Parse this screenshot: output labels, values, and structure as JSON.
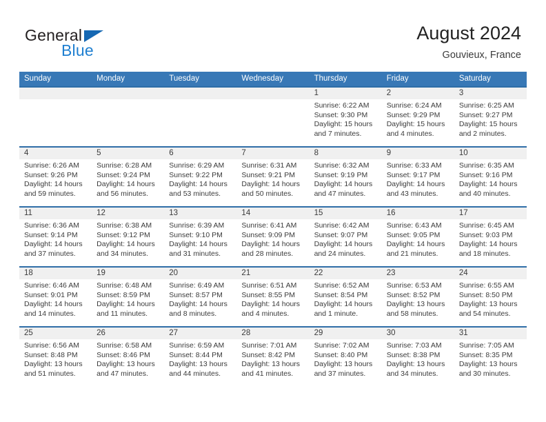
{
  "logo": {
    "text_top": "General",
    "text_bottom": "Blue",
    "triangle_color": "#1668b3",
    "blue_color": "#1f7fd0"
  },
  "header": {
    "title": "August 2024",
    "subtitle": "Gouvieux, France"
  },
  "theme": {
    "header_row_bg": "#3878b6",
    "row_divider": "#2e6da7",
    "daynum_band_bg": "#f0f0f0",
    "text": "#3a3a3a"
  },
  "weekdays": [
    "Sunday",
    "Monday",
    "Tuesday",
    "Wednesday",
    "Thursday",
    "Friday",
    "Saturday"
  ],
  "weeks": [
    [
      {
        "day": "",
        "sunrise": "",
        "sunset": "",
        "daylight1": "",
        "daylight2": ""
      },
      {
        "day": "",
        "sunrise": "",
        "sunset": "",
        "daylight1": "",
        "daylight2": ""
      },
      {
        "day": "",
        "sunrise": "",
        "sunset": "",
        "daylight1": "",
        "daylight2": ""
      },
      {
        "day": "",
        "sunrise": "",
        "sunset": "",
        "daylight1": "",
        "daylight2": ""
      },
      {
        "day": "1",
        "sunrise": "Sunrise: 6:22 AM",
        "sunset": "Sunset: 9:30 PM",
        "daylight1": "Daylight: 15 hours",
        "daylight2": "and 7 minutes."
      },
      {
        "day": "2",
        "sunrise": "Sunrise: 6:24 AM",
        "sunset": "Sunset: 9:29 PM",
        "daylight1": "Daylight: 15 hours",
        "daylight2": "and 4 minutes."
      },
      {
        "day": "3",
        "sunrise": "Sunrise: 6:25 AM",
        "sunset": "Sunset: 9:27 PM",
        "daylight1": "Daylight: 15 hours",
        "daylight2": "and 2 minutes."
      }
    ],
    [
      {
        "day": "4",
        "sunrise": "Sunrise: 6:26 AM",
        "sunset": "Sunset: 9:26 PM",
        "daylight1": "Daylight: 14 hours",
        "daylight2": "and 59 minutes."
      },
      {
        "day": "5",
        "sunrise": "Sunrise: 6:28 AM",
        "sunset": "Sunset: 9:24 PM",
        "daylight1": "Daylight: 14 hours",
        "daylight2": "and 56 minutes."
      },
      {
        "day": "6",
        "sunrise": "Sunrise: 6:29 AM",
        "sunset": "Sunset: 9:22 PM",
        "daylight1": "Daylight: 14 hours",
        "daylight2": "and 53 minutes."
      },
      {
        "day": "7",
        "sunrise": "Sunrise: 6:31 AM",
        "sunset": "Sunset: 9:21 PM",
        "daylight1": "Daylight: 14 hours",
        "daylight2": "and 50 minutes."
      },
      {
        "day": "8",
        "sunrise": "Sunrise: 6:32 AM",
        "sunset": "Sunset: 9:19 PM",
        "daylight1": "Daylight: 14 hours",
        "daylight2": "and 47 minutes."
      },
      {
        "day": "9",
        "sunrise": "Sunrise: 6:33 AM",
        "sunset": "Sunset: 9:17 PM",
        "daylight1": "Daylight: 14 hours",
        "daylight2": "and 43 minutes."
      },
      {
        "day": "10",
        "sunrise": "Sunrise: 6:35 AM",
        "sunset": "Sunset: 9:16 PM",
        "daylight1": "Daylight: 14 hours",
        "daylight2": "and 40 minutes."
      }
    ],
    [
      {
        "day": "11",
        "sunrise": "Sunrise: 6:36 AM",
        "sunset": "Sunset: 9:14 PM",
        "daylight1": "Daylight: 14 hours",
        "daylight2": "and 37 minutes."
      },
      {
        "day": "12",
        "sunrise": "Sunrise: 6:38 AM",
        "sunset": "Sunset: 9:12 PM",
        "daylight1": "Daylight: 14 hours",
        "daylight2": "and 34 minutes."
      },
      {
        "day": "13",
        "sunrise": "Sunrise: 6:39 AM",
        "sunset": "Sunset: 9:10 PM",
        "daylight1": "Daylight: 14 hours",
        "daylight2": "and 31 minutes."
      },
      {
        "day": "14",
        "sunrise": "Sunrise: 6:41 AM",
        "sunset": "Sunset: 9:09 PM",
        "daylight1": "Daylight: 14 hours",
        "daylight2": "and 28 minutes."
      },
      {
        "day": "15",
        "sunrise": "Sunrise: 6:42 AM",
        "sunset": "Sunset: 9:07 PM",
        "daylight1": "Daylight: 14 hours",
        "daylight2": "and 24 minutes."
      },
      {
        "day": "16",
        "sunrise": "Sunrise: 6:43 AM",
        "sunset": "Sunset: 9:05 PM",
        "daylight1": "Daylight: 14 hours",
        "daylight2": "and 21 minutes."
      },
      {
        "day": "17",
        "sunrise": "Sunrise: 6:45 AM",
        "sunset": "Sunset: 9:03 PM",
        "daylight1": "Daylight: 14 hours",
        "daylight2": "and 18 minutes."
      }
    ],
    [
      {
        "day": "18",
        "sunrise": "Sunrise: 6:46 AM",
        "sunset": "Sunset: 9:01 PM",
        "daylight1": "Daylight: 14 hours",
        "daylight2": "and 14 minutes."
      },
      {
        "day": "19",
        "sunrise": "Sunrise: 6:48 AM",
        "sunset": "Sunset: 8:59 PM",
        "daylight1": "Daylight: 14 hours",
        "daylight2": "and 11 minutes."
      },
      {
        "day": "20",
        "sunrise": "Sunrise: 6:49 AM",
        "sunset": "Sunset: 8:57 PM",
        "daylight1": "Daylight: 14 hours",
        "daylight2": "and 8 minutes."
      },
      {
        "day": "21",
        "sunrise": "Sunrise: 6:51 AM",
        "sunset": "Sunset: 8:55 PM",
        "daylight1": "Daylight: 14 hours",
        "daylight2": "and 4 minutes."
      },
      {
        "day": "22",
        "sunrise": "Sunrise: 6:52 AM",
        "sunset": "Sunset: 8:54 PM",
        "daylight1": "Daylight: 14 hours",
        "daylight2": "and 1 minute."
      },
      {
        "day": "23",
        "sunrise": "Sunrise: 6:53 AM",
        "sunset": "Sunset: 8:52 PM",
        "daylight1": "Daylight: 13 hours",
        "daylight2": "and 58 minutes."
      },
      {
        "day": "24",
        "sunrise": "Sunrise: 6:55 AM",
        "sunset": "Sunset: 8:50 PM",
        "daylight1": "Daylight: 13 hours",
        "daylight2": "and 54 minutes."
      }
    ],
    [
      {
        "day": "25",
        "sunrise": "Sunrise: 6:56 AM",
        "sunset": "Sunset: 8:48 PM",
        "daylight1": "Daylight: 13 hours",
        "daylight2": "and 51 minutes."
      },
      {
        "day": "26",
        "sunrise": "Sunrise: 6:58 AM",
        "sunset": "Sunset: 8:46 PM",
        "daylight1": "Daylight: 13 hours",
        "daylight2": "and 47 minutes."
      },
      {
        "day": "27",
        "sunrise": "Sunrise: 6:59 AM",
        "sunset": "Sunset: 8:44 PM",
        "daylight1": "Daylight: 13 hours",
        "daylight2": "and 44 minutes."
      },
      {
        "day": "28",
        "sunrise": "Sunrise: 7:01 AM",
        "sunset": "Sunset: 8:42 PM",
        "daylight1": "Daylight: 13 hours",
        "daylight2": "and 41 minutes."
      },
      {
        "day": "29",
        "sunrise": "Sunrise: 7:02 AM",
        "sunset": "Sunset: 8:40 PM",
        "daylight1": "Daylight: 13 hours",
        "daylight2": "and 37 minutes."
      },
      {
        "day": "30",
        "sunrise": "Sunrise: 7:03 AM",
        "sunset": "Sunset: 8:38 PM",
        "daylight1": "Daylight: 13 hours",
        "daylight2": "and 34 minutes."
      },
      {
        "day": "31",
        "sunrise": "Sunrise: 7:05 AM",
        "sunset": "Sunset: 8:35 PM",
        "daylight1": "Daylight: 13 hours",
        "daylight2": "and 30 minutes."
      }
    ]
  ]
}
